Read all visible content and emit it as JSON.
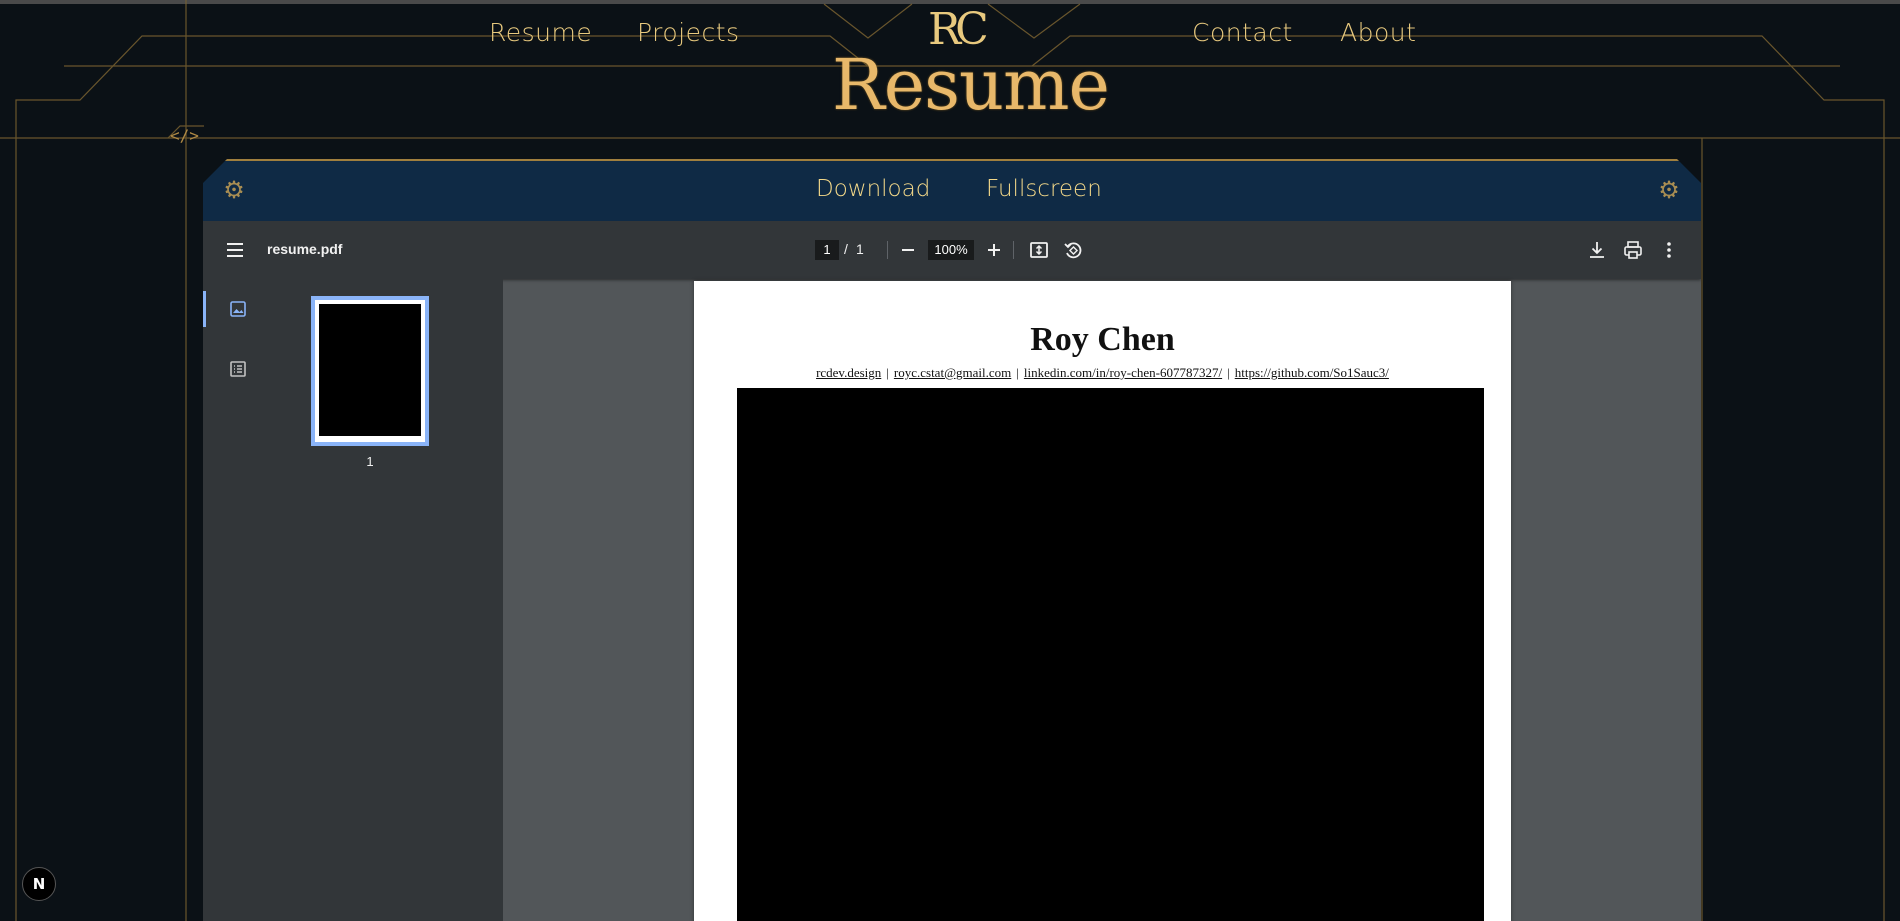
{
  "nav": {
    "left": [
      "Resume",
      "Projects"
    ],
    "right": [
      "Contact",
      "About"
    ],
    "logo": "RC",
    "title": "Resume",
    "code_glyph": "</>"
  },
  "viewer_bar": {
    "download": "Download",
    "fullscreen": "Fullscreen"
  },
  "pdf_toolbar": {
    "filename": "resume.pdf",
    "current_page": "1",
    "page_sep": "/",
    "total_pages": "1",
    "zoom": "100%"
  },
  "sidebar": {
    "thumbnail_label": "1"
  },
  "document": {
    "name": "Roy Chen",
    "links": [
      "rcdev.design",
      "royc.cstat@gmail.com",
      "linkedin.com/in/roy-chen-607787327/",
      "https://github.com/So1Sauc3/"
    ],
    "separator": "|"
  },
  "badge": {
    "label": "N"
  },
  "colors": {
    "gold": "#e8c97e",
    "navy_bar": "#0f2a45",
    "pdf_toolbar": "#323639",
    "pdf_bg": "#525659",
    "thumb_accent": "#8ab4f8"
  }
}
